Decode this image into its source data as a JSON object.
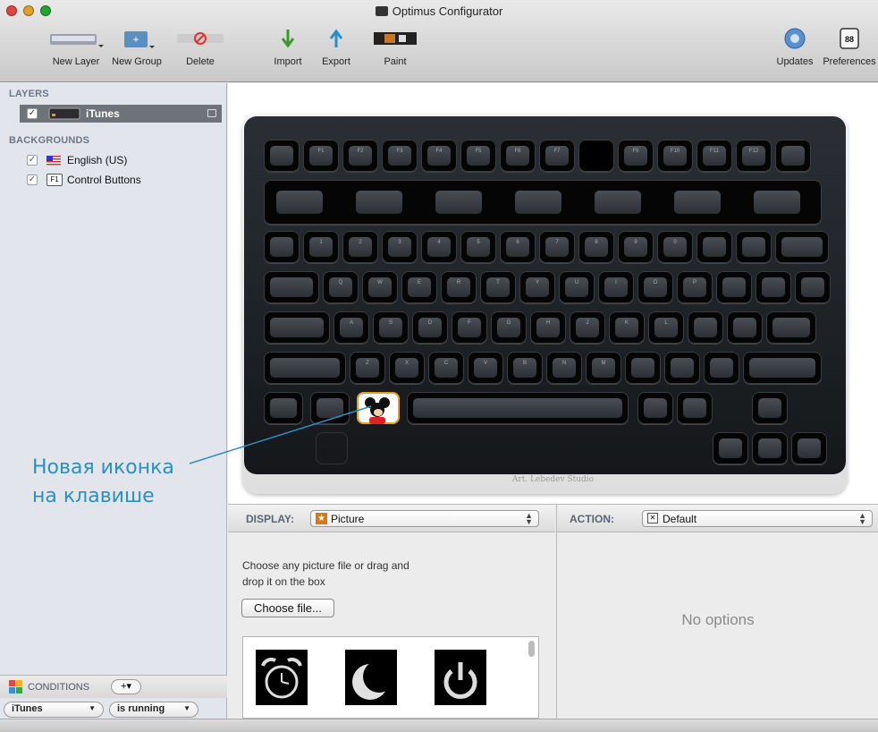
{
  "window": {
    "title": "Optimus Configurator"
  },
  "toolbar": {
    "new_layer": "New Layer",
    "new_group": "New Group",
    "delete": "Delete",
    "import": "Import",
    "export": "Export",
    "paint": "Paint",
    "updates": "Updates",
    "preferences": "Preferences"
  },
  "sidebar": {
    "layers_header": "LAYERS",
    "layer_item": "iTunes",
    "backgrounds_header": "BACKGROUNDS",
    "backgrounds": [
      {
        "label": "English (US)",
        "badge": "flag"
      },
      {
        "label": "Control Buttons",
        "badge": "F1"
      }
    ],
    "conditions_header": "CONDITIONS",
    "condition_app": "iTunes",
    "condition_state": "is running"
  },
  "keyboard": {
    "brand": "Art. Lebedev Studio",
    "f_keys": [
      "F1",
      "F2",
      "F3",
      "F4",
      "F5",
      "F6",
      "F7",
      "F9",
      "F10",
      "F11",
      "F12"
    ],
    "number_keys": [
      "1",
      "2",
      "3",
      "4",
      "5",
      "6",
      "7",
      "8",
      "9",
      "0"
    ],
    "row_q": [
      "Q",
      "W",
      "E",
      "R",
      "T",
      "Y",
      "U",
      "I",
      "O",
      "P"
    ],
    "row_a": [
      "A",
      "S",
      "D",
      "F",
      "G",
      "H",
      "J",
      "K",
      "L"
    ],
    "row_z": [
      "Z",
      "X",
      "C",
      "V",
      "B",
      "N",
      "M"
    ]
  },
  "display": {
    "label": "DISPLAY:",
    "value": "Picture",
    "help": "Choose any picture file or drag and drop it on the box",
    "choose": "Choose file..."
  },
  "action": {
    "label": "ACTION:",
    "value": "Default",
    "no_options": "No options"
  },
  "annotation": {
    "line1": "Новая иконка",
    "line2": "на клавише"
  },
  "colors": {
    "annotation": "#2b8fbf",
    "accent_key_border": "#e0a020"
  }
}
